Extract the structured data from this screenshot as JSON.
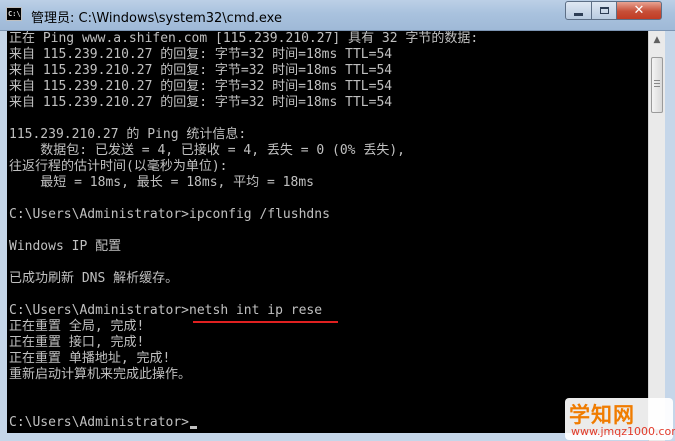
{
  "window": {
    "title": "管理员: C:\\Windows\\system32\\cmd.exe",
    "icon": "cmd-icon",
    "icon_text": "C:\\",
    "controls": {
      "minimize_icon": "minimize-icon",
      "maximize_icon": "maximize-icon",
      "close_icon": "close-icon",
      "close_glyph": "✕"
    }
  },
  "console": {
    "text_color": "#c0c0c0",
    "background": "#000000",
    "highlight_color": "#e02020",
    "lines": [
      "正在 Ping www.a.shifen.com [115.239.210.27] 具有 32 字节的数据:",
      "来自 115.239.210.27 的回复: 字节=32 时间=18ms TTL=54",
      "来自 115.239.210.27 的回复: 字节=32 时间=18ms TTL=54",
      "来自 115.239.210.27 的回复: 字节=32 时间=18ms TTL=54",
      "来自 115.239.210.27 的回复: 字节=32 时间=18ms TTL=54",
      "",
      "115.239.210.27 的 Ping 统计信息:",
      "    数据包: 已发送 = 4, 已接收 = 4, 丢失 = 0 (0% 丢失),",
      "往返行程的估计时间(以毫秒为单位):",
      "    最短 = 18ms, 最长 = 18ms, 平均 = 18ms",
      "",
      "C:\\Users\\Administrator>ipconfig /flushdns",
      "",
      "Windows IP 配置",
      "",
      "已成功刷新 DNS 解析缓存。",
      "",
      "C:\\Users\\Administrator>netsh int ip rese",
      "正在重置 全局, 完成!",
      "正在重置 接口, 完成!",
      "正在重置 单播地址, 完成!",
      "重新启动计算机来完成此操作。",
      "",
      "C:\\Users\\Administrator>"
    ]
  },
  "scrollbar": {
    "up_arrow": "▲",
    "down_arrow": "▼"
  },
  "watermark": {
    "brand": "学知网",
    "url": "www.jmqz1000.com"
  }
}
